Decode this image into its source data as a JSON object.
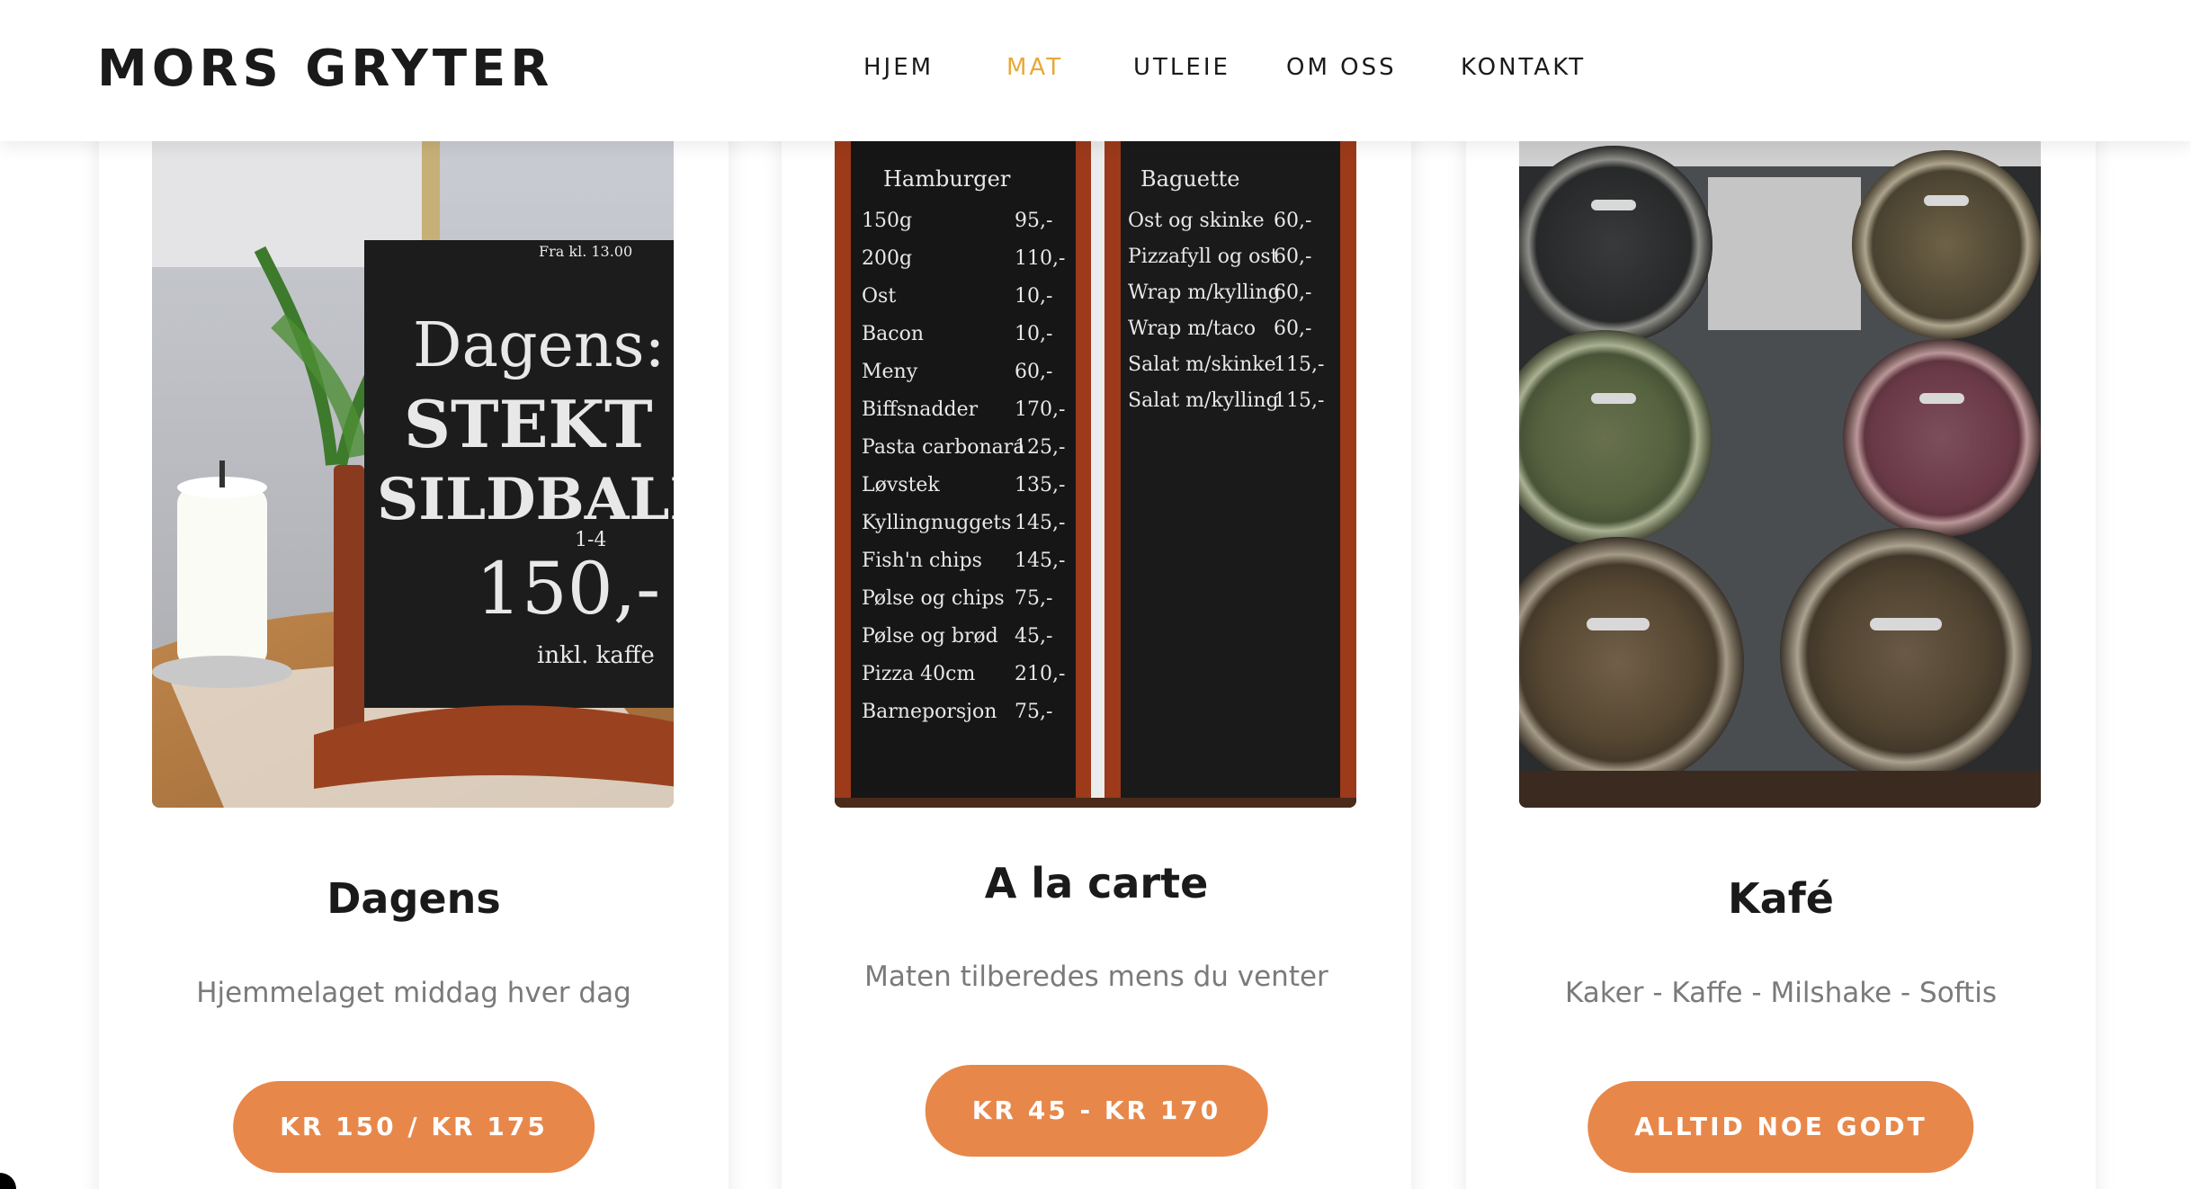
{
  "header": {
    "logo": "MORS GRYTER",
    "nav": [
      {
        "label": "HJEM",
        "active": false
      },
      {
        "label": "MAT",
        "active": true
      },
      {
        "label": "UTLEIE",
        "active": false
      },
      {
        "label": "OM OSS",
        "active": false
      },
      {
        "label": "KONTAKT",
        "active": false
      }
    ]
  },
  "cards": [
    {
      "title": "Dagens",
      "subtitle": "Hjemmelaget middag hver dag",
      "button": "KR 150 / KR 175",
      "image": {
        "sign_lines": [
          "Fra kl. 13.00",
          "Dagens:",
          "STEKT",
          "SILDBALL",
          "1-4",
          "150,-",
          "inkl. kaffe"
        ]
      }
    },
    {
      "title": "A la carte",
      "subtitle": "Maten tilberedes mens du venter",
      "button": "KR 45 - KR 170",
      "image": {
        "left_board_title": "Hamburger",
        "left_board": [
          {
            "item": "150g",
            "price": "95,-"
          },
          {
            "item": "200g",
            "price": "110,-"
          },
          {
            "item": "Ost",
            "price": "10,-"
          },
          {
            "item": "Bacon",
            "price": "10,-"
          },
          {
            "item": "Meny",
            "price": "60,-"
          },
          {
            "item": "Biffsnadder",
            "price": "170,-"
          },
          {
            "item": "Pasta carbonara",
            "price": "125,-"
          },
          {
            "item": "Løvstek",
            "price": "135,-"
          },
          {
            "item": "Kyllingnuggets",
            "price": "145,-"
          },
          {
            "item": "Fish'n chips",
            "price": "145,-"
          },
          {
            "item": "Pølse og chips",
            "price": "75,-"
          },
          {
            "item": "Pølse og brød",
            "price": "45,-"
          },
          {
            "item": "Pizza 40cm",
            "price": "210,-"
          },
          {
            "item": "Barneporsjon",
            "price": "75,-"
          }
        ],
        "right_board_title": "Baguette",
        "right_board": [
          {
            "item": "Ost og skinke",
            "price": "60,-"
          },
          {
            "item": "Pizzafyll og ost",
            "price": "60,-"
          },
          {
            "item": "Wrap m/kylling",
            "price": "60,-"
          },
          {
            "item": "Wrap m/taco",
            "price": "60,-"
          },
          {
            "item": "Salat m/skinke",
            "price": "115,-"
          },
          {
            "item": "Salat m/kylling",
            "price": "115,-"
          }
        ]
      }
    },
    {
      "title": "Kafé",
      "subtitle": "Kaker - Kaffe - Milshake - Softis",
      "button": "ALLTID NOE GODT",
      "image": {}
    }
  ],
  "colors": {
    "accent": "#e8a838",
    "button": "#e8874a",
    "text": "#1a1a1a",
    "muted": "#7a7a7a"
  }
}
